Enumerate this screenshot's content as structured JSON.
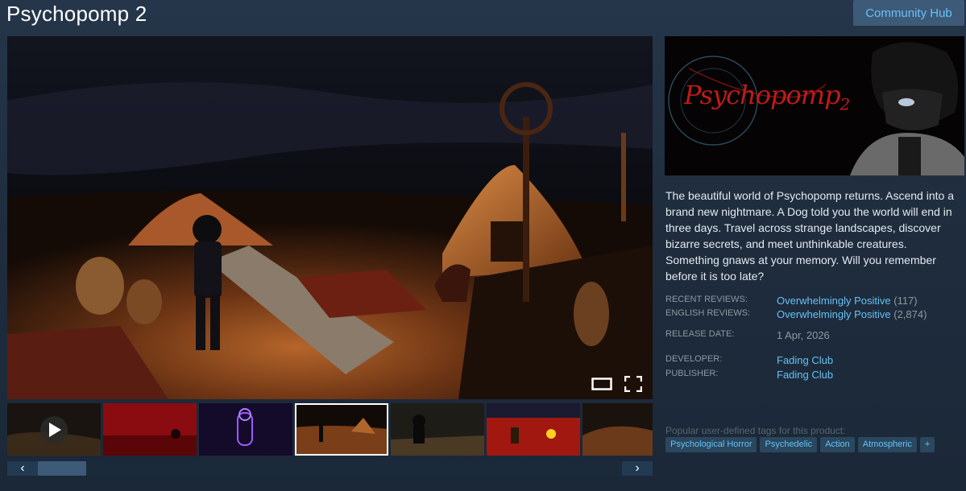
{
  "app": {
    "title": "Psychopomp 2",
    "community_hub_label": "Community Hub"
  },
  "media": {
    "player_controls": [
      "window-mode-icon",
      "fullscreen-icon"
    ],
    "thumbnails": [
      {
        "kind": "video",
        "icon": "play-icon"
      },
      {
        "kind": "screenshot"
      },
      {
        "kind": "screenshot"
      },
      {
        "kind": "screenshot",
        "selected": true
      },
      {
        "kind": "screenshot"
      },
      {
        "kind": "screenshot"
      },
      {
        "kind": "screenshot"
      }
    ],
    "scroll_left_icon": "‹",
    "scroll_right_icon": "›"
  },
  "capsule": {
    "logo_text": "Psychopomp",
    "logo_number": "2"
  },
  "description": "The beautiful world of Psychopomp returns. Ascend into a brand new nightmare. A Dog told you the world will end in three days. Travel across strange landscapes, discover bizarre secrets, and meet unthinkable creatures. Something gnaws at your memory. Will you remember before it is too late?",
  "reviews": {
    "recent_label": "RECENT REVIEWS:",
    "recent_value": "Overwhelmingly Positive",
    "recent_count": "(117)",
    "english_label": "ENGLISH REVIEWS:",
    "english_value": "Overwhelmingly Positive",
    "english_count": "(2,874)"
  },
  "release": {
    "label": "RELEASE DATE:",
    "date": "1 Apr, 2026"
  },
  "developer": {
    "label": "DEVELOPER:",
    "name": "Fading Club"
  },
  "publisher": {
    "label": "PUBLISHER:",
    "name": "Fading Club"
  },
  "tags": {
    "label": "Popular user-defined tags for this product:",
    "items": [
      "Psychological Horror",
      "Psychedelic",
      "Action",
      "Atmospheric",
      "+"
    ]
  },
  "colors": {
    "background": "#1b2838",
    "link": "#66c0f4",
    "tag_bg": "#2a475e",
    "button_bg": "#3d5a78"
  }
}
